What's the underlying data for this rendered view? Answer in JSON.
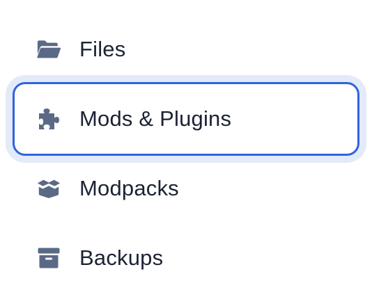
{
  "menu": {
    "items": [
      {
        "label": "Files",
        "icon": "folder-open-icon",
        "selected": false
      },
      {
        "label": "Mods & Plugins",
        "icon": "puzzle-piece-icon",
        "selected": true
      },
      {
        "label": "Modpacks",
        "icon": "box-open-icon",
        "selected": false
      },
      {
        "label": "Backups",
        "icon": "archive-box-icon",
        "selected": false
      }
    ]
  },
  "colors": {
    "icon": "#5a6a86",
    "text": "#1b2233",
    "focus_border": "#2f63e0",
    "focus_halo": "#e3eafa",
    "background": "#ffffff"
  }
}
